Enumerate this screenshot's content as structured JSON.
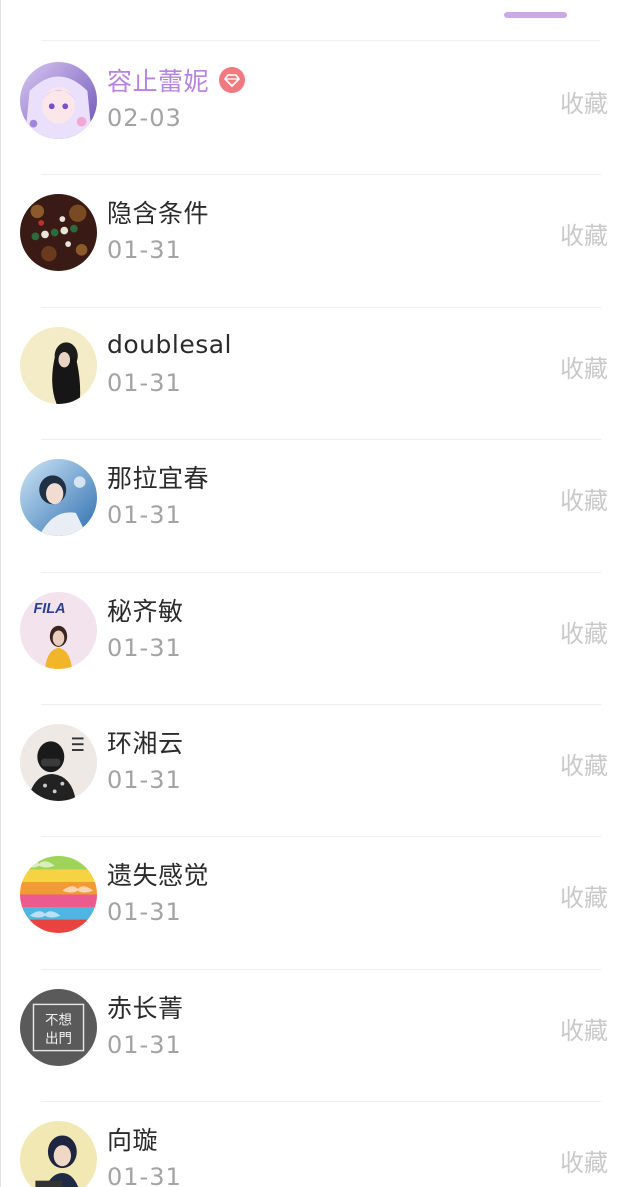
{
  "entries": [
    {
      "name": "容止蕾妮",
      "date": "02-03",
      "action": "收藏",
      "vip": true,
      "avatar": "anime-girl-purple-hair"
    },
    {
      "name": "隐含条件",
      "date": "01-31",
      "action": "收藏",
      "vip": false,
      "avatar": "beads-on-leopard-print"
    },
    {
      "name": "doublesal",
      "date": "01-31",
      "action": "收藏",
      "vip": false,
      "avatar": "girl-long-black-hair"
    },
    {
      "name": "那拉宜春",
      "date": "01-31",
      "action": "收藏",
      "vip": false,
      "avatar": "girl-blue-portrait"
    },
    {
      "name": "秘齐敏",
      "date": "01-31",
      "action": "收藏",
      "vip": false,
      "avatar": "fila-girl-yellow-top"
    },
    {
      "name": "环湘云",
      "date": "01-31",
      "action": "收藏",
      "vip": false,
      "avatar": "masked-person-bw"
    },
    {
      "name": "遗失感觉",
      "date": "01-31",
      "action": "收藏",
      "vip": false,
      "avatar": "rainbow-mustache-pattern"
    },
    {
      "name": "赤长菁",
      "date": "01-31",
      "action": "收藏",
      "vip": false,
      "avatar": "calligraphy-text-grey"
    },
    {
      "name": "向璇",
      "date": "01-31",
      "action": "收藏",
      "vip": false,
      "avatar": "girl-dark-hair-yellow"
    }
  ],
  "avatar_text": {
    "fila": "FILA",
    "calligraphy": [
      "不想",
      "出門"
    ]
  },
  "colors": {
    "vip_name": "#b882e0",
    "tab_indicator": "#c9a9e6",
    "vip_badge": "#f07a82",
    "date": "#a3a3a3",
    "action": "#c9c9c9"
  }
}
